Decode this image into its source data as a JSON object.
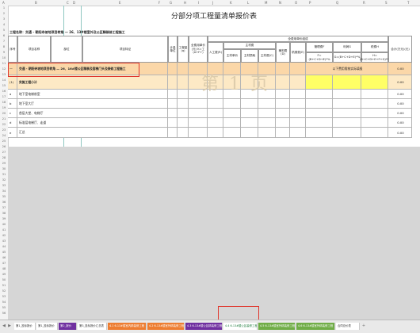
{
  "sheet": {
    "title": "分部分项工程量清单报价表",
    "project_name": "工程名称：交通 - 朝阳寺坡地项目转角 — 26、13#楼室外及公区精装修工程施工",
    "watermark": "第 1 页"
  },
  "column_letters": [
    "A",
    "B",
    "C",
    "D",
    "E",
    "F",
    "G",
    "H",
    "I",
    "J",
    "K",
    "L",
    "M",
    "N",
    "O",
    "P",
    "Q",
    "R",
    "S",
    "T"
  ],
  "row_numbers": [
    "1",
    "2",
    "3",
    "4",
    "5",
    "6",
    "7",
    "8",
    "9",
    "10",
    "11",
    "12",
    "13",
    "14",
    "15",
    "16",
    "17",
    "18",
    "19",
    "20",
    "21",
    "22",
    "23",
    "24",
    "25",
    "26",
    "27",
    "28",
    "29",
    "30",
    "31",
    "32",
    "33",
    "34",
    "35",
    "36",
    "37",
    "38",
    "39",
    "40",
    "41",
    "42",
    "43",
    "44",
    "45",
    "46",
    "47",
    "48",
    "49",
    "50",
    "51",
    "52",
    "53",
    "54",
    "55",
    "56"
  ],
  "header": {
    "seq": "序号",
    "item_name": "项目名称",
    "unit_name": "部位",
    "feature": "项目特征",
    "measure_unit": "计量单位",
    "quantity": "工程量(q)",
    "unit_price": "全费用单价(元) K=工(A+F+)",
    "composition": "全费用单价组成",
    "labor": "人工费(R)",
    "material_group": "主材费",
    "main_material": "主材单价",
    "material_loss": "主材损耗",
    "material_total": "主材费(C)",
    "aux_material": "辅材费(D)",
    "machine": "机械费(E)",
    "mgmt_fee": "管理费F",
    "mgmt_formula": "F=(B+C+D+E)*%",
    "profit": "利润G",
    "profit_formula": "G=(B+C+D+E)*%",
    "tax": "税费H",
    "tax_formula": "H=(B+C+D+E+F+G)*%",
    "total": "合计(万元)(元)"
  },
  "rows": [
    {
      "seq": "一",
      "name": "交通 - 朝阳寺坡地项目转角 — 26、16#楼公区精装及客梯门头及装修工程施工",
      "note": "以下费用需按实际填报",
      "total": "0.00",
      "style": "orange"
    },
    {
      "seq": "(1)",
      "name": "实施工程小计",
      "note": "",
      "total": "0.00",
      "style": "yellow"
    },
    {
      "seq": "a",
      "name": "地下室电梯前室",
      "note": "",
      "total": "0.00",
      "style": "plain"
    },
    {
      "seq": "b",
      "name": "地下室大厅",
      "note": "",
      "total": "0.00",
      "style": "plain"
    },
    {
      "seq": "c",
      "name": "首层大堂、电梯厅",
      "note": "",
      "total": "0.00",
      "style": "plain"
    },
    {
      "seq": "d",
      "name": "标准层电梯厅、走道",
      "note": "",
      "total": "0.00",
      "style": "plain"
    },
    {
      "seq": "e",
      "name": "汇总",
      "note": "",
      "total": "0.00",
      "style": "plain"
    }
  ],
  "tabs": [
    {
      "label": "第1_投标报价",
      "color": "#ffffff",
      "text": "#333333"
    },
    {
      "label": "第1_投标报价",
      "color": "#ffffff",
      "text": "#333333"
    },
    {
      "label": "第2_报价",
      "color": "#7030a0",
      "text": "#ffffff"
    },
    {
      "label": "第3_投标报价汇总表",
      "color": "#ffffff",
      "text": "#333333"
    },
    {
      "label": "4.1 6-13#楼室内精装修工程",
      "color": "#ed7d31",
      "text": "#ffffff"
    },
    {
      "label": "4.2 6-13#楼室外精装修工程",
      "color": "#ed7d31",
      "text": "#ffffff"
    },
    {
      "label": "4.3 6-13#楼公区精装修工程",
      "color": "#7030a0",
      "text": "#ffffff"
    },
    {
      "label": "4.4 6-13#楼公区装修工程",
      "color": "#ffffff",
      "text": "#333333"
    },
    {
      "label": "4.5 6-13#楼室外精装修工程",
      "color": "#70ad47",
      "text": "#ffffff"
    },
    {
      "label": "4.6 6-13#楼室外精装修工程",
      "color": "#70ad47",
      "text": "#ffffff"
    },
    {
      "label": "合同总价表",
      "color": "#ffffff",
      "text": "#333333"
    }
  ],
  "active_tab_index": 7,
  "colors": {
    "orange_row": "#fbd7a8",
    "yellow_row": "#ffff66",
    "highlight_red": "#e0362c",
    "grid_gray": "#d6d6d6"
  }
}
